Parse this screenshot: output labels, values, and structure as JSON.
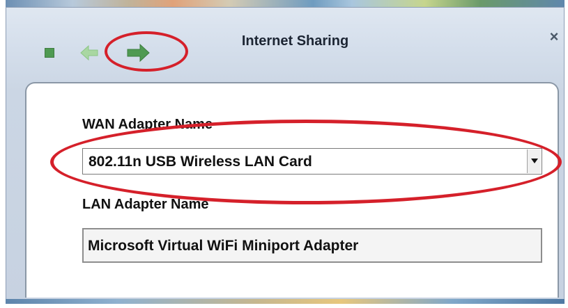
{
  "window": {
    "title": "Internet Sharing",
    "close_symbol": "×"
  },
  "toolbar": {
    "stop_icon": "stop-icon",
    "back_icon": "back-arrow-icon",
    "forward_icon": "forward-arrow-icon"
  },
  "form": {
    "wan_label": "WAN Adapter Name",
    "wan_selected": "802.11n USB Wireless LAN Card",
    "lan_label": "LAN Adapter Name",
    "lan_value": "Microsoft Virtual WiFi Miniport Adapter"
  },
  "colors": {
    "annotation_red": "#d5202a",
    "icon_green": "#4f9a52",
    "icon_green_faded": "#9fcf9a"
  }
}
